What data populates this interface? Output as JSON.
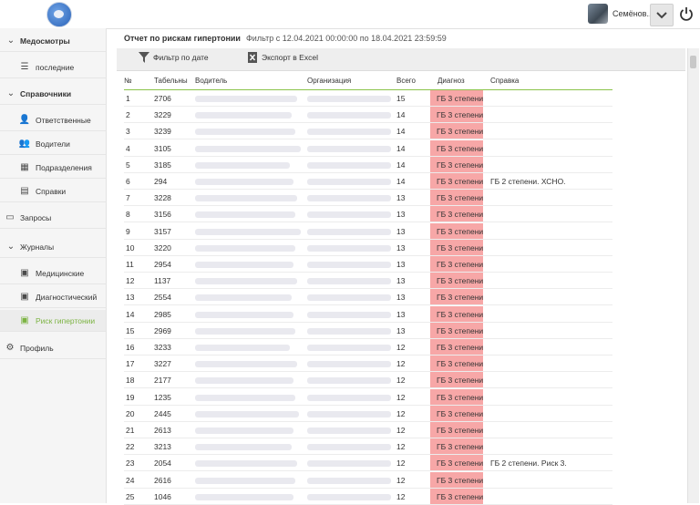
{
  "user": {
    "name": "Семёнов..."
  },
  "sidebar": {
    "items": [
      {
        "label": "Медосмотры",
        "icon": "chevron-down-icon",
        "group": true
      },
      {
        "label": "последние",
        "icon": "list-icon"
      },
      {
        "label": "Справочники",
        "icon": "chevron-down-icon",
        "group": true
      },
      {
        "label": "Ответственные",
        "icon": "user-icon"
      },
      {
        "label": "Водители",
        "icon": "users-icon"
      },
      {
        "label": "Подразделения",
        "icon": "building-icon"
      },
      {
        "label": "Справки",
        "icon": "document-icon"
      },
      {
        "label": "Запросы",
        "icon": "id-card-icon"
      },
      {
        "label": "Журналы",
        "icon": "chevron-down-icon"
      },
      {
        "label": "Медицинские",
        "icon": "journal-icon"
      },
      {
        "label": "Диагностический",
        "icon": "journal-icon"
      },
      {
        "label": "Риск гипертонии",
        "icon": "journal-icon",
        "active": true
      },
      {
        "label": "Профиль",
        "icon": "gear-icon"
      }
    ]
  },
  "report": {
    "title": "Отчет по рискам гипертонии",
    "filter": "Фильтр с 12.04.2021 00:00:00 по 18.04.2021 23:59:59"
  },
  "toolbar": {
    "filter_label": "Фильтр по дате",
    "export_label": "Экспорт в Excel"
  },
  "table": {
    "headers": [
      "№",
      "Табельны",
      "Водитель",
      "Организация",
      "Всего",
      "Диагноз",
      "Справка"
    ],
    "rows": [
      {
        "n": "1",
        "tab": "2706",
        "total": "15",
        "diag": "ГБ 3 степени",
        "spr": ""
      },
      {
        "n": "2",
        "tab": "3229",
        "total": "14",
        "diag": "ГБ 3 степени",
        "spr": ""
      },
      {
        "n": "3",
        "tab": "3239",
        "total": "14",
        "diag": "ГБ 3 степени",
        "spr": ""
      },
      {
        "n": "4",
        "tab": "3105",
        "total": "14",
        "diag": "ГБ 3 степени",
        "spr": ""
      },
      {
        "n": "5",
        "tab": "3185",
        "total": "14",
        "diag": "ГБ 3 степени",
        "spr": ""
      },
      {
        "n": "6",
        "tab": "294",
        "total": "14",
        "diag": "ГБ 3 степени",
        "spr": "ГБ 2 степени. ХСНО."
      },
      {
        "n": "7",
        "tab": "3228",
        "total": "13",
        "diag": "ГБ 3 степени",
        "spr": ""
      },
      {
        "n": "8",
        "tab": "3156",
        "total": "13",
        "diag": "ГБ 3 степени",
        "spr": ""
      },
      {
        "n": "9",
        "tab": "3157",
        "total": "13",
        "diag": "ГБ 3 степени",
        "spr": ""
      },
      {
        "n": "10",
        "tab": "3220",
        "total": "13",
        "diag": "ГБ 3 степени",
        "spr": ""
      },
      {
        "n": "11",
        "tab": "2954",
        "total": "13",
        "diag": "ГБ 3 степени",
        "spr": ""
      },
      {
        "n": "12",
        "tab": "1137",
        "total": "13",
        "diag": "ГБ 3 степени",
        "spr": ""
      },
      {
        "n": "13",
        "tab": "2554",
        "total": "13",
        "diag": "ГБ 3 степени",
        "spr": ""
      },
      {
        "n": "14",
        "tab": "2985",
        "total": "13",
        "diag": "ГБ 3 степени",
        "spr": ""
      },
      {
        "n": "15",
        "tab": "2969",
        "total": "13",
        "diag": "ГБ 3 степени",
        "spr": ""
      },
      {
        "n": "16",
        "tab": "3233",
        "total": "12",
        "diag": "ГБ 3 степени",
        "spr": ""
      },
      {
        "n": "17",
        "tab": "3227",
        "total": "12",
        "diag": "ГБ 3 степени",
        "spr": ""
      },
      {
        "n": "18",
        "tab": "2177",
        "total": "12",
        "diag": "ГБ 3 степени",
        "spr": ""
      },
      {
        "n": "19",
        "tab": "1235",
        "total": "12",
        "diag": "ГБ 3 степени",
        "spr": ""
      },
      {
        "n": "20",
        "tab": "2445",
        "total": "12",
        "diag": "ГБ 3 степени",
        "spr": ""
      },
      {
        "n": "21",
        "tab": "2613",
        "total": "12",
        "diag": "ГБ 3 степени",
        "spr": ""
      },
      {
        "n": "22",
        "tab": "3213",
        "total": "12",
        "diag": "ГБ 3 степени",
        "spr": ""
      },
      {
        "n": "23",
        "tab": "2054",
        "total": "12",
        "diag": "ГБ 3 степени",
        "spr": "ГБ 2 степени. Риск 3."
      },
      {
        "n": "24",
        "tab": "2616",
        "total": "12",
        "diag": "ГБ 3 степени",
        "spr": ""
      },
      {
        "n": "25",
        "tab": "1046",
        "total": "12",
        "diag": "ГБ 3 степени",
        "spr": ""
      }
    ]
  },
  "colors": {
    "accent": "#7cb342",
    "diagnosis_bg": "#f7a7a7"
  }
}
